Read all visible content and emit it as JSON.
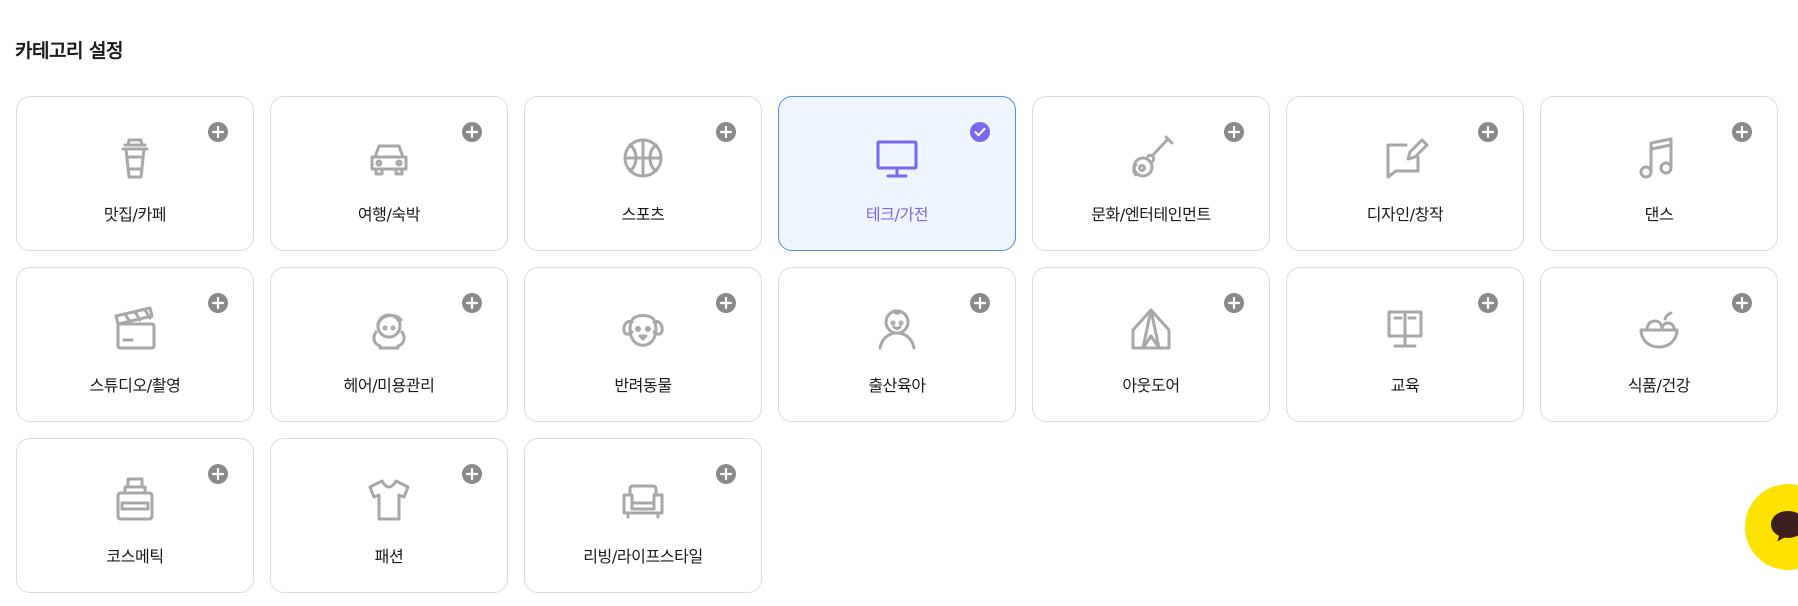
{
  "section": {
    "title": "카테고리 설정"
  },
  "categories": [
    {
      "label": "맛집/카페",
      "icon": "cup-icon",
      "selected": false
    },
    {
      "label": "여행/숙박",
      "icon": "car-icon",
      "selected": false
    },
    {
      "label": "스포츠",
      "icon": "basketball-icon",
      "selected": false
    },
    {
      "label": "테크/가전",
      "icon": "monitor-icon",
      "selected": true
    },
    {
      "label": "문화/엔터테인먼트",
      "icon": "guitar-icon",
      "selected": false
    },
    {
      "label": "디자인/창작",
      "icon": "pencil-note-icon",
      "selected": false
    },
    {
      "label": "댄스",
      "icon": "music-note-icon",
      "selected": false
    },
    {
      "label": "스튜디오/촬영",
      "icon": "clapperboard-icon",
      "selected": false
    },
    {
      "label": "헤어/미용관리",
      "icon": "hair-girl-icon",
      "selected": false
    },
    {
      "label": "반려동물",
      "icon": "dog-icon",
      "selected": false
    },
    {
      "label": "출산육아",
      "icon": "baby-icon",
      "selected": false
    },
    {
      "label": "아웃도어",
      "icon": "tent-icon",
      "selected": false
    },
    {
      "label": "교육",
      "icon": "book-stand-icon",
      "selected": false
    },
    {
      "label": "식품/건강",
      "icon": "fruit-bowl-icon",
      "selected": false
    },
    {
      "label": "코스메틱",
      "icon": "cosmetic-bottle-icon",
      "selected": false
    },
    {
      "label": "패션",
      "icon": "tshirt-icon",
      "selected": false
    },
    {
      "label": "리빙/라이프스타일",
      "icon": "sofa-icon",
      "selected": false
    }
  ],
  "colors": {
    "selected_accent": "#7b68ee",
    "selected_background": "#eef5ff",
    "selected_border": "#4a90e2",
    "icon_gray": "#a8a8a8",
    "badge_gray": "#8a8a8a",
    "chat_button": "#ffe200",
    "chat_icon": "#3c1e1e"
  },
  "chat_button": {
    "icon": "chat-bubble-icon"
  }
}
